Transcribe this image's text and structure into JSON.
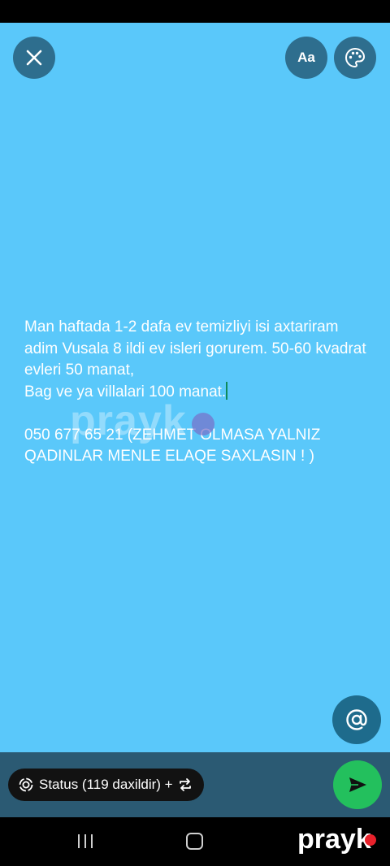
{
  "toolbar": {
    "text_style_label": "Aa"
  },
  "status_text": {
    "body": "Man haftada 1-2 dafa ev temizliyi isi axtariram adim Vusala 8 ildi ev isleri gorurem. 50-60 kvadrat evleri 50 manat,\nBag ve ya villalari 100 manat.",
    "contact": "\n050 677 65 21 (ZEHMET OLMASA YALNIZ QADINLAR MENLE ELAQE SAXLASIN ! )",
    "background_color": "#5AC8FA"
  },
  "watermark": {
    "text": "prayk"
  },
  "bottom": {
    "audience_label": "Status (119 daxildir) +"
  },
  "logo": {
    "text": "prayk",
    "dot_color": "#E8212B"
  },
  "icons": [
    "close-icon",
    "palette-icon",
    "at-icon",
    "status-ring-icon",
    "swap-icon",
    "send-icon",
    "recents-icon",
    "home-icon"
  ]
}
